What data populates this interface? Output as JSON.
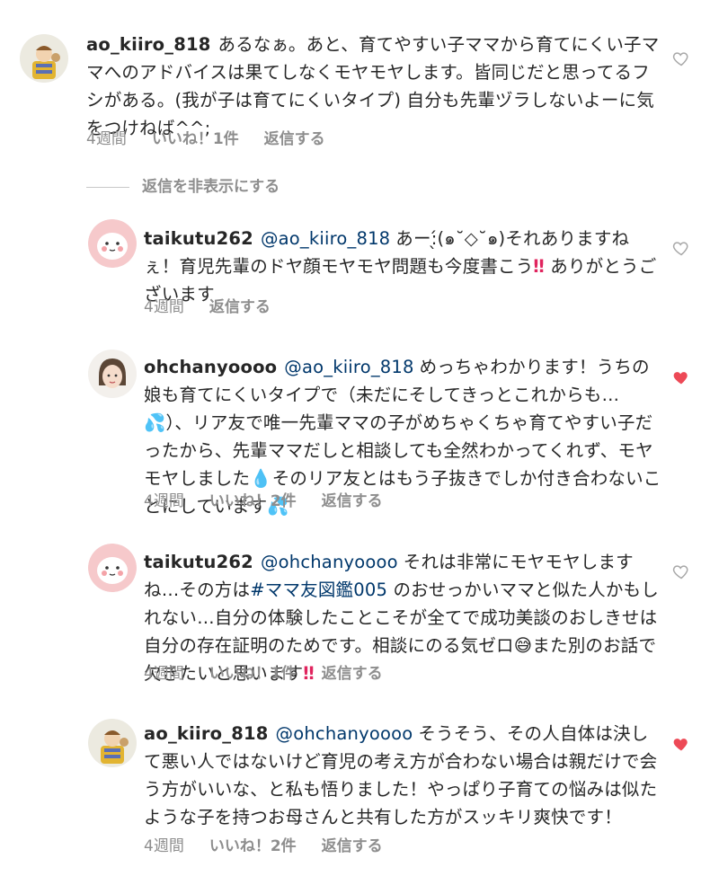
{
  "heart_colors": {
    "liked": "#ed4956",
    "unliked": "#a8a8a8"
  },
  "hide_replies_label": "返信を非表示にする",
  "comments": [
    {
      "username": "ao_kiiro_818",
      "mention": "",
      "text": "あるなぁ。あと、育てやすい子ママから育てにくい子ママへのアドバイスは果てしなくモヤモヤします。皆同じだと思ってるフシがある。(我が子は育てにくいタイプ) 自分も先輩ヅラしないよーに気をつけねば^^;",
      "time": "4週間",
      "likes": "いいね！1件",
      "reply": "返信する",
      "liked": false
    },
    {
      "username": "taikutu262",
      "mention": "@ao_kiiro_818",
      "text_a": "あー:̖́(๑˘◇˘๑)それありますねぇ！育児先輩のドヤ顔モヤモヤ問題も今度書こう",
      "text_b": "ありがとうございます",
      "time": "4週間",
      "reply": "返信する",
      "liked": false
    },
    {
      "username": "ohchanyoooo",
      "mention": "@ao_kiiro_818",
      "text_a": "めっちゃわかります！うちの娘も育てにくいタイプで（未だにそしてきっとこれからも…",
      "text_b": "）、リア友で唯一先輩ママの子がめちゃくちゃ育てやすい子だったから、先輩ママだしと相談しても全然わかってくれず、モヤモヤしました",
      "text_c": "そのリア友とはもう子抜きでしか付き合わないことにしています",
      "time": "4週間",
      "likes": "いいね！2件",
      "reply": "返信する",
      "liked": true
    },
    {
      "username": "taikutu262",
      "mention": "@ohchanyoooo",
      "text_a": "それは非常にモヤモヤしますね…その方は",
      "hashtag": "#ママ友図鑑005",
      "text_b": " のおせっかいママと似た人かもしれない…自分の体験したことこそが全てで成功美談のおしきせは自分の存在証明のためです。相談にのる気ゼロ",
      "text_c": "また別のお話で欠きたいと思います",
      "time": "4週間",
      "likes": "いいね！1件",
      "reply": "返信する",
      "liked": false
    },
    {
      "username": "ao_kiiro_818",
      "mention": "@ohchanyoooo",
      "text": "そうそう、その人自体は決して悪い人ではないけど育児の考え方が合わない場合は親だけで会う方がいいな、と私も悟りました！やっぱり子育ての悩みは似たような子を持つお母さんと共有した方がスッキリ爽快です！",
      "time": "4週間",
      "likes": "いいね！2件",
      "reply": "返信する",
      "liked": true
    }
  ],
  "emoji": {
    "double_exclaim": "‼",
    "sweat": "💦",
    "drop": "💧",
    "grin_sweat": "😅"
  }
}
